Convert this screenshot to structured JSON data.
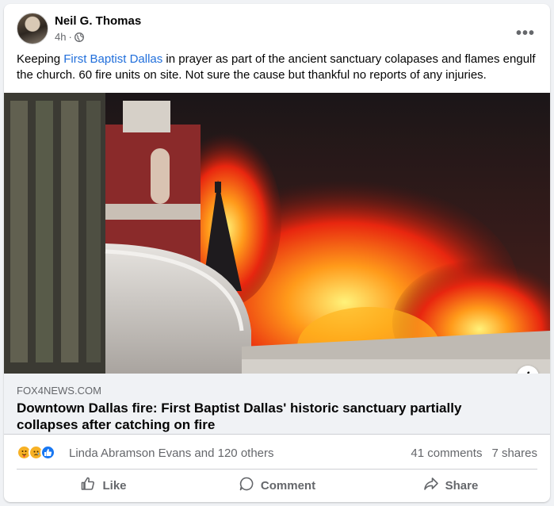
{
  "post": {
    "author": "Neil G. Thomas",
    "time": "4h",
    "separator": "·",
    "privacy_icon": "globe-icon",
    "more_icon": "more-options-icon",
    "text_before": "Keeping ",
    "mention": "First Baptist Dallas",
    "text_after": " in prayer as part of the ancient sanctuary colapases and flames engulf the church.  60 fire units on site.  Not sure the cause but thankful no reports of any injuries."
  },
  "link": {
    "domain": "FOX4NEWS.COM",
    "title": "Downtown Dallas fire: First Baptist Dallas' historic sanctuary partially collapses after catching on fire",
    "info_label": "i"
  },
  "stats": {
    "reaction_icons": [
      "care-icon",
      "sad-icon",
      "like-icon"
    ],
    "reactors": "Linda Abramson Evans and 120 others",
    "comments": "41 comments",
    "shares": "7 shares"
  },
  "actions": {
    "like": "Like",
    "comment": "Comment",
    "share": "Share"
  },
  "colors": {
    "link_blue": "#216fdb",
    "secondary_text": "#65676b",
    "like_blue": "#1877f2",
    "card_background": "#f0f2f5"
  }
}
